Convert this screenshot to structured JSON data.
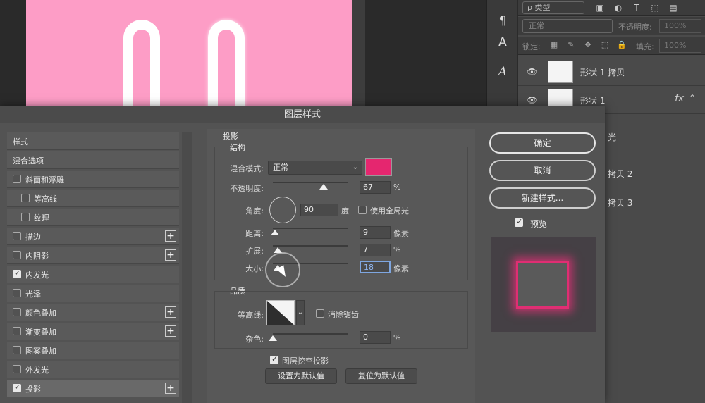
{
  "layers_panel": {
    "kind_filter": "ρ 类型",
    "blend_mode": "正常",
    "opacity_label": "不透明度:",
    "opacity_value": "100%",
    "lock_label": "锁定:",
    "fill_label": "填充:",
    "fill_value": "100%",
    "layers": [
      {
        "name": "形状 1 拷贝",
        "has_fx": false
      },
      {
        "name": "形状 1",
        "has_fx": true,
        "fx_label": "fx"
      }
    ],
    "peek_items": [
      "光",
      "拷贝 2",
      "拷贝 3"
    ]
  },
  "dialog": {
    "title": "图层样式",
    "style_list": [
      {
        "label": "样式",
        "checkbox": false,
        "plus": false
      },
      {
        "label": "混合选项",
        "checkbox": false,
        "plus": false
      },
      {
        "label": "斜面和浮雕",
        "checkbox": true,
        "checked": false,
        "plus": false
      },
      {
        "label": "等高线",
        "checkbox": true,
        "checked": false,
        "plus": false,
        "indent": true
      },
      {
        "label": "纹理",
        "checkbox": true,
        "checked": false,
        "plus": false,
        "indent": true
      },
      {
        "label": "描边",
        "checkbox": true,
        "checked": false,
        "plus": true
      },
      {
        "label": "内阴影",
        "checkbox": true,
        "checked": false,
        "plus": true
      },
      {
        "label": "内发光",
        "checkbox": true,
        "checked": true,
        "plus": false
      },
      {
        "label": "光泽",
        "checkbox": true,
        "checked": false,
        "plus": false
      },
      {
        "label": "颜色叠加",
        "checkbox": true,
        "checked": false,
        "plus": true
      },
      {
        "label": "渐变叠加",
        "checkbox": true,
        "checked": false,
        "plus": true
      },
      {
        "label": "图案叠加",
        "checkbox": true,
        "checked": false,
        "plus": false
      },
      {
        "label": "外发光",
        "checkbox": true,
        "checked": false,
        "plus": false
      },
      {
        "label": "投影",
        "checkbox": true,
        "checked": true,
        "plus": true,
        "active": true
      }
    ],
    "drop_shadow": {
      "section_title": "投影",
      "structure_title": "结构",
      "blend_mode_label": "混合模式:",
      "blend_mode_value": "正常",
      "shadow_color": "#e5266f",
      "opacity_label": "不透明度:",
      "opacity_value": "67",
      "opacity_unit": "%",
      "opacity_level": 0.67,
      "angle_label": "角度:",
      "angle_value": "90",
      "angle_unit": "度",
      "global_light_label": "使用全局光",
      "global_light_checked": false,
      "distance_label": "距离:",
      "distance_value": "9",
      "distance_unit": "像素",
      "distance_level": 0.03,
      "spread_label": "扩展:",
      "spread_value": "7",
      "spread_unit": "%",
      "spread_level": 0.07,
      "size_label": "大小:",
      "size_value": "18",
      "size_unit": "像素",
      "size_level": 0.07,
      "quality_title": "品质",
      "contour_label": "等高线:",
      "anti_alias_label": "消除锯齿",
      "anti_alias_checked": false,
      "noise_label": "杂色:",
      "noise_value": "0",
      "noise_unit": "%",
      "noise_level": 0,
      "knockout_label": "图层挖空投影",
      "knockout_checked": true,
      "make_default_label": "设置为默认值",
      "reset_default_label": "复位为默认值"
    },
    "buttons": {
      "ok": "确定",
      "cancel": "取消",
      "new_style": "新建样式...",
      "preview_label": "预览",
      "preview_checked": true
    },
    "preview_glow_color": "#e02e73"
  }
}
